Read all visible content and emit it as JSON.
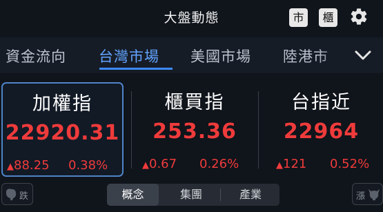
{
  "header": {
    "title": "大盤動態",
    "btn_listed": "市",
    "btn_otc": "櫃",
    "settings_icon": "gear-icon"
  },
  "tabs": [
    {
      "label": "資金流向",
      "active": false
    },
    {
      "label": "台灣市場",
      "active": true
    },
    {
      "label": "美國市場",
      "active": false
    },
    {
      "label": "陸港市",
      "active": false
    }
  ],
  "indices": [
    {
      "name": "加權指",
      "value": "22920.31",
      "change": "88.25",
      "percent": "0.38%",
      "direction": "up",
      "selected": true
    },
    {
      "name": "櫃買指",
      "value": "253.36",
      "change": "0.67",
      "percent": "0.26%",
      "direction": "up",
      "selected": false
    },
    {
      "name": "台指近",
      "value": "22964",
      "change": "121",
      "percent": "0.52%",
      "direction": "up",
      "selected": false
    }
  ],
  "bottom": {
    "fall_label": "跌",
    "rise_label": "漲",
    "segments": [
      {
        "label": "概念",
        "active": true
      },
      {
        "label": "集團",
        "active": false
      },
      {
        "label": "產業",
        "active": false
      }
    ]
  },
  "colors": {
    "background": "#10141b",
    "up": "#ef3b3b",
    "accent": "#3d8bff",
    "card_border": "#4f84c8"
  }
}
